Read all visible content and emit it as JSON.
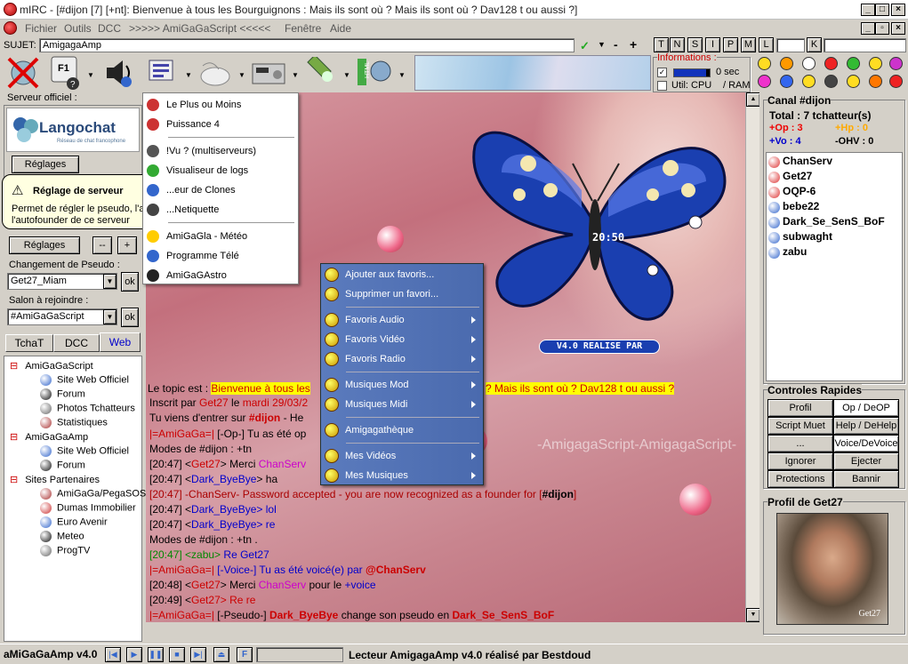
{
  "window": {
    "title": "mIRC - [#dijon [7] [+nt]: Bienvenue à tous les Bourguignons : Mais ils sont où ? Mais ils sont où ? Dav128 t ou aussi ?]"
  },
  "menubar": [
    "Fichier",
    "Outils",
    "DCC",
    ">>>>> AmiGaGaScript <<<<<",
    "Fenêtre",
    "Aide"
  ],
  "subject": {
    "label": "SUJET:",
    "value": "AmigagaAmp"
  },
  "mode_buttons": [
    "T",
    "N",
    "S",
    "I",
    "P",
    "M",
    "L",
    "K"
  ],
  "info": {
    "title": "Informations :",
    "lag": "0 sec",
    "util": "Util: CPU",
    "ram": "/ RAM"
  },
  "left": {
    "server_title": "Serveur officiel :",
    "langochat": "Langochat",
    "langochat_sub": "Réseau de chat francophone",
    "reglages": "Réglages",
    "tooltip_title": "Réglage de serveur",
    "tooltip_text": "Permet de régler le pseudo, l'autojoin et l'autofounder de ce serveur",
    "reglages2": "Réglages",
    "minus": "--",
    "plus": "+",
    "pseudo_title": "Changement de Pseudo :",
    "pseudo_value": "Get27_Miam",
    "ok": "ok",
    "salon_title": "Salon à rejoindre :",
    "salon_value": "#AmiGaGaScript",
    "tabs": [
      "TchaT",
      "DCC",
      "Web"
    ],
    "tree": [
      {
        "label": "AmiGaGaScript",
        "level": 0
      },
      {
        "label": "Site Web Officiel",
        "level": 1
      },
      {
        "label": "Forum",
        "level": 1
      },
      {
        "label": "Photos Tchatteurs",
        "level": 1
      },
      {
        "label": "Statistiques",
        "level": 1
      },
      {
        "label": "AmiGaGaAmp",
        "level": 0
      },
      {
        "label": "Site Web Officiel",
        "level": 1
      },
      {
        "label": "Forum",
        "level": 1
      },
      {
        "label": "Sites Partenaires",
        "level": 0
      },
      {
        "label": "AmiGaGa/PegaSOS",
        "level": 1
      },
      {
        "label": "Dumas Immobilier",
        "level": 1
      },
      {
        "label": "Euro Avenir",
        "level": 1
      },
      {
        "label": "Meteo",
        "level": 1
      },
      {
        "label": "ProgTV",
        "level": 1
      }
    ]
  },
  "toolsmenu": [
    {
      "label": "Le Plus ou Moins",
      "icon": "plusminus-icon"
    },
    {
      "label": "Puissance 4",
      "icon": "connect4-icon"
    },
    {
      "sep": true
    },
    {
      "label": "!Vu ? (multiserveurs)",
      "icon": "seen-icon"
    },
    {
      "label": "Visualiseur de logs",
      "icon": "logs-icon"
    },
    {
      "label": "...eur de Clones",
      "icon": "clones-icon"
    },
    {
      "label": "...Netiquette",
      "icon": "netiquette-icon"
    },
    {
      "sep": true
    },
    {
      "label": "AmiGaGla - Météo",
      "icon": "weather-icon"
    },
    {
      "label": "Programme Télé",
      "icon": "tv-icon"
    },
    {
      "label": "AmiGaGAstro",
      "icon": "astro-icon"
    }
  ],
  "ampmenu": [
    {
      "label": "Ajouter aux favoris...",
      "sub": false
    },
    {
      "label": "Supprimer un favori...",
      "sub": false
    },
    {
      "sep": true
    },
    {
      "label": "Favoris Audio",
      "sub": true
    },
    {
      "label": "Favoris Vidéo",
      "sub": true
    },
    {
      "label": "Favoris Radio",
      "sub": true
    },
    {
      "sep": true
    },
    {
      "label": "Musiques Mod",
      "sub": true
    },
    {
      "label": "Musiques Midi",
      "sub": true
    },
    {
      "sep": true
    },
    {
      "label": "Amigagathèque",
      "sub": false
    },
    {
      "sep": true
    },
    {
      "label": "Mes Vidéos",
      "sub": true
    },
    {
      "label": "Mes Musiques",
      "sub": true
    }
  ],
  "player": {
    "time": "20:50",
    "caption": "V4.0 REALISE PAR"
  },
  "watermark": "-AmigagaScript-AmigagaScript-",
  "chat": {
    "topic_prefix": "Le topic est :",
    "topic_a": "Bienvenue à tous les",
    "topic_b": "? Mais ils sont où ? Dav128 t ou aussi ?",
    "lines": [
      {
        "parts": [
          [
            "Inscrit par ",
            "#000"
          ],
          [
            "Get27",
            "#c00"
          ],
          [
            " le ",
            "#000"
          ],
          [
            "mardi 29/03/2",
            "#c00"
          ]
        ]
      },
      {
        "parts": [
          [
            " Tu viens d'entrer sur  ",
            "#000"
          ],
          [
            "#dijon",
            "#c00"
          ],
          [
            " -  He",
            "#000"
          ]
        ]
      },
      {
        "parts": [
          [
            "|=AmiGaGa=|",
            "#c00"
          ],
          [
            " [-Op-] Tu as été op",
            "#000"
          ]
        ]
      },
      {
        "parts": [
          [
            " Modes de #dijon : +tn",
            "#000"
          ]
        ]
      },
      {
        "parts": [
          [
            "[20:47] <",
            "#000"
          ],
          [
            "Get27",
            "#c00"
          ],
          [
            "> Merci ",
            "#000"
          ],
          [
            "ChanServ",
            "#c0c"
          ]
        ]
      },
      {
        "parts": [
          [
            "[20:47] <",
            "#000"
          ],
          [
            "Dark_ByeBye",
            "#00c"
          ],
          [
            "> ha",
            "#000"
          ]
        ]
      },
      {
        "parts": [
          [
            "[20:47] -ChanServ- Password accepted - you are now recognized as a founder for [",
            "#a00"
          ],
          [
            "#dijon",
            "#000"
          ],
          [
            "]",
            "#a00"
          ]
        ]
      },
      {
        "parts": [
          [
            "[20:47] <",
            "#000"
          ],
          [
            "Dark_ByeBye",
            "#00c"
          ],
          [
            "> lol",
            "#00c"
          ]
        ]
      },
      {
        "parts": [
          [
            "[20:47] <",
            "#000"
          ],
          [
            "Dark_ByeBye",
            "#00c"
          ],
          [
            "> re",
            "#00c"
          ]
        ]
      },
      {
        "parts": [
          [
            " Modes de #dijon : +tn .",
            "#000"
          ]
        ]
      },
      {
        "parts": [
          [
            "[20:47] <zabu> ",
            "#080"
          ],
          [
            "Re Get27",
            "#00c"
          ]
        ]
      },
      {
        "parts": [
          [
            "|=AmiGaGa=|",
            "#c00"
          ],
          [
            " [-Voice-] Tu as été voicé(e) par ",
            "#00c"
          ],
          [
            "@ChanServ",
            "#c00"
          ]
        ]
      },
      {
        "parts": [
          [
            "[20:48] <",
            "#000"
          ],
          [
            "Get27",
            "#c00"
          ],
          [
            "> Merci ",
            "#000"
          ],
          [
            "ChanServ",
            "#c0c"
          ],
          [
            " pour le ",
            "#000"
          ],
          [
            "+voice",
            "#00c"
          ]
        ]
      },
      {
        "parts": [
          [
            "[20:49] <",
            "#000"
          ],
          [
            "Get27",
            "#c00"
          ],
          [
            "> Re re",
            "#c00"
          ]
        ]
      },
      {
        "parts": [
          [
            "|=AmiGaGa=|",
            "#c00"
          ],
          [
            " [-Pseudo-] ",
            "#000"
          ],
          [
            "Dark_ByeBye",
            "#c00"
          ],
          [
            " change son pseudo en ",
            "#000"
          ],
          [
            "Dark_Se_SenS_BoF",
            "#c00"
          ]
        ]
      }
    ]
  },
  "channel": {
    "title": "Canal #dijon",
    "total": "Total : 7 tchatteur(s)",
    "op": "+Op : 3",
    "hp": "+Hp : 0",
    "vo": "+Vo : 4",
    "ohv": "-OHV : 0",
    "nicks": [
      {
        "n": "ChanServ",
        "t": "op"
      },
      {
        "n": "Get27",
        "t": "op"
      },
      {
        "n": "OQP-6",
        "t": "op"
      },
      {
        "n": "bebe22",
        "t": "vo"
      },
      {
        "n": "Dark_Se_SenS_BoF",
        "t": "vo"
      },
      {
        "n": "subwaght",
        "t": "vo"
      },
      {
        "n": "zabu",
        "t": "vo"
      }
    ]
  },
  "controls": {
    "title": "Controles Rapides",
    "buttons": [
      "Profil",
      "Op / DeOP",
      "Script Muet",
      "Help / DeHelp",
      "...",
      "Voice/DeVoice",
      "Ignorer",
      "Ejecter",
      "Protections",
      "Bannir"
    ]
  },
  "profile": {
    "title": "Profil de Get27",
    "caption": "Get27"
  },
  "statusbar": {
    "app": "aMiGaGaAmp v4.0",
    "status": "Lecteur AmigagaAmp v4.0 réalisé par Bestdoud"
  }
}
